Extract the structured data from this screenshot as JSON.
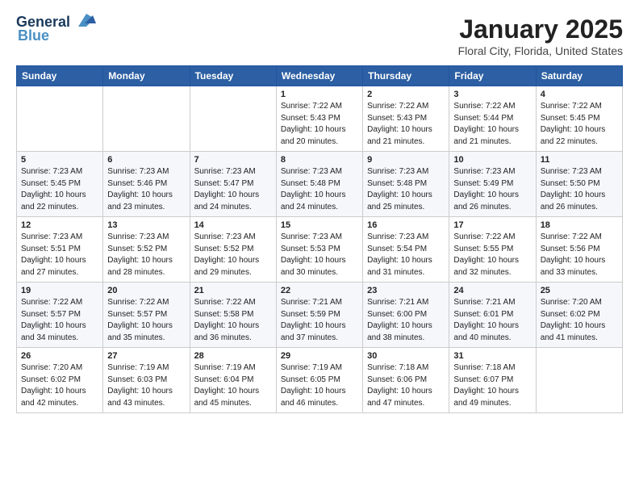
{
  "header": {
    "logo_line1": "General",
    "logo_line2": "Blue",
    "month": "January 2025",
    "location": "Floral City, Florida, United States"
  },
  "weekdays": [
    "Sunday",
    "Monday",
    "Tuesday",
    "Wednesday",
    "Thursday",
    "Friday",
    "Saturday"
  ],
  "weeks": [
    [
      {
        "day": "",
        "info": ""
      },
      {
        "day": "",
        "info": ""
      },
      {
        "day": "",
        "info": ""
      },
      {
        "day": "1",
        "info": "Sunrise: 7:22 AM\nSunset: 5:43 PM\nDaylight: 10 hours\nand 20 minutes."
      },
      {
        "day": "2",
        "info": "Sunrise: 7:22 AM\nSunset: 5:43 PM\nDaylight: 10 hours\nand 21 minutes."
      },
      {
        "day": "3",
        "info": "Sunrise: 7:22 AM\nSunset: 5:44 PM\nDaylight: 10 hours\nand 21 minutes."
      },
      {
        "day": "4",
        "info": "Sunrise: 7:22 AM\nSunset: 5:45 PM\nDaylight: 10 hours\nand 22 minutes."
      }
    ],
    [
      {
        "day": "5",
        "info": "Sunrise: 7:23 AM\nSunset: 5:45 PM\nDaylight: 10 hours\nand 22 minutes."
      },
      {
        "day": "6",
        "info": "Sunrise: 7:23 AM\nSunset: 5:46 PM\nDaylight: 10 hours\nand 23 minutes."
      },
      {
        "day": "7",
        "info": "Sunrise: 7:23 AM\nSunset: 5:47 PM\nDaylight: 10 hours\nand 24 minutes."
      },
      {
        "day": "8",
        "info": "Sunrise: 7:23 AM\nSunset: 5:48 PM\nDaylight: 10 hours\nand 24 minutes."
      },
      {
        "day": "9",
        "info": "Sunrise: 7:23 AM\nSunset: 5:48 PM\nDaylight: 10 hours\nand 25 minutes."
      },
      {
        "day": "10",
        "info": "Sunrise: 7:23 AM\nSunset: 5:49 PM\nDaylight: 10 hours\nand 26 minutes."
      },
      {
        "day": "11",
        "info": "Sunrise: 7:23 AM\nSunset: 5:50 PM\nDaylight: 10 hours\nand 26 minutes."
      }
    ],
    [
      {
        "day": "12",
        "info": "Sunrise: 7:23 AM\nSunset: 5:51 PM\nDaylight: 10 hours\nand 27 minutes."
      },
      {
        "day": "13",
        "info": "Sunrise: 7:23 AM\nSunset: 5:52 PM\nDaylight: 10 hours\nand 28 minutes."
      },
      {
        "day": "14",
        "info": "Sunrise: 7:23 AM\nSunset: 5:52 PM\nDaylight: 10 hours\nand 29 minutes."
      },
      {
        "day": "15",
        "info": "Sunrise: 7:23 AM\nSunset: 5:53 PM\nDaylight: 10 hours\nand 30 minutes."
      },
      {
        "day": "16",
        "info": "Sunrise: 7:23 AM\nSunset: 5:54 PM\nDaylight: 10 hours\nand 31 minutes."
      },
      {
        "day": "17",
        "info": "Sunrise: 7:22 AM\nSunset: 5:55 PM\nDaylight: 10 hours\nand 32 minutes."
      },
      {
        "day": "18",
        "info": "Sunrise: 7:22 AM\nSunset: 5:56 PM\nDaylight: 10 hours\nand 33 minutes."
      }
    ],
    [
      {
        "day": "19",
        "info": "Sunrise: 7:22 AM\nSunset: 5:57 PM\nDaylight: 10 hours\nand 34 minutes."
      },
      {
        "day": "20",
        "info": "Sunrise: 7:22 AM\nSunset: 5:57 PM\nDaylight: 10 hours\nand 35 minutes."
      },
      {
        "day": "21",
        "info": "Sunrise: 7:22 AM\nSunset: 5:58 PM\nDaylight: 10 hours\nand 36 minutes."
      },
      {
        "day": "22",
        "info": "Sunrise: 7:21 AM\nSunset: 5:59 PM\nDaylight: 10 hours\nand 37 minutes."
      },
      {
        "day": "23",
        "info": "Sunrise: 7:21 AM\nSunset: 6:00 PM\nDaylight: 10 hours\nand 38 minutes."
      },
      {
        "day": "24",
        "info": "Sunrise: 7:21 AM\nSunset: 6:01 PM\nDaylight: 10 hours\nand 40 minutes."
      },
      {
        "day": "25",
        "info": "Sunrise: 7:20 AM\nSunset: 6:02 PM\nDaylight: 10 hours\nand 41 minutes."
      }
    ],
    [
      {
        "day": "26",
        "info": "Sunrise: 7:20 AM\nSunset: 6:02 PM\nDaylight: 10 hours\nand 42 minutes."
      },
      {
        "day": "27",
        "info": "Sunrise: 7:19 AM\nSunset: 6:03 PM\nDaylight: 10 hours\nand 43 minutes."
      },
      {
        "day": "28",
        "info": "Sunrise: 7:19 AM\nSunset: 6:04 PM\nDaylight: 10 hours\nand 45 minutes."
      },
      {
        "day": "29",
        "info": "Sunrise: 7:19 AM\nSunset: 6:05 PM\nDaylight: 10 hours\nand 46 minutes."
      },
      {
        "day": "30",
        "info": "Sunrise: 7:18 AM\nSunset: 6:06 PM\nDaylight: 10 hours\nand 47 minutes."
      },
      {
        "day": "31",
        "info": "Sunrise: 7:18 AM\nSunset: 6:07 PM\nDaylight: 10 hours\nand 49 minutes."
      },
      {
        "day": "",
        "info": ""
      }
    ]
  ]
}
